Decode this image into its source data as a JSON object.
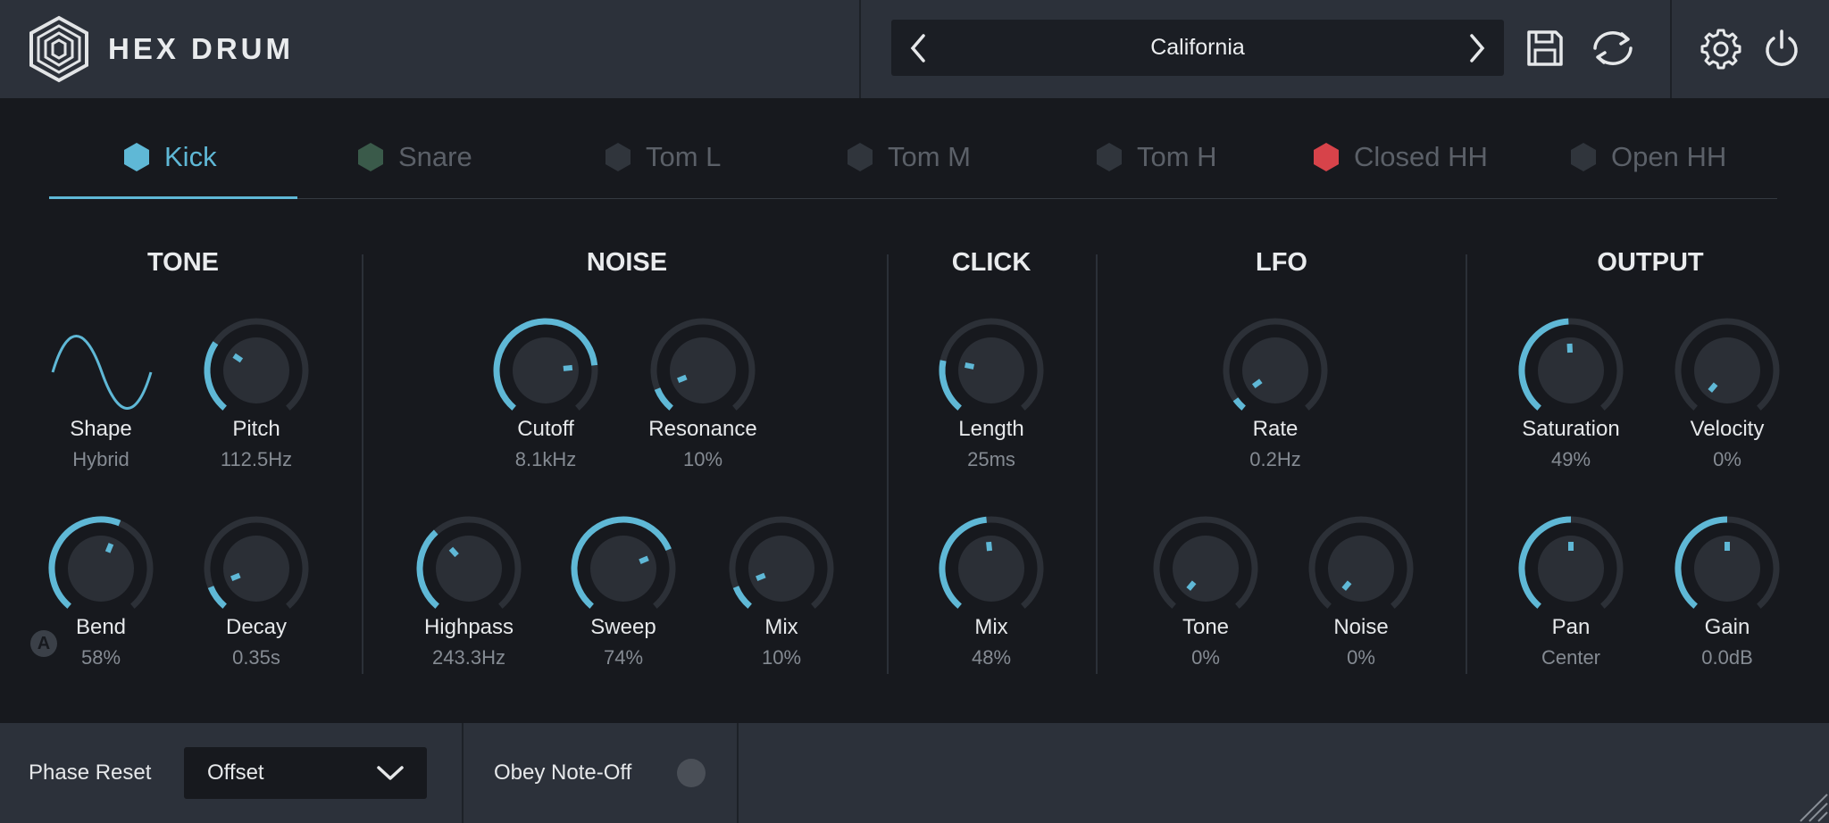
{
  "app": {
    "title": "HEX DRUM"
  },
  "preset": {
    "name": "California"
  },
  "colors": {
    "accent": "#5fb8d6",
    "knob_track": "#2c3037",
    "knob_body": "#2b2f36",
    "closed_hh": "#d7434a",
    "snare": "#3a5a4a"
  },
  "icons": [
    "logo-hex-icon",
    "chevron-left-icon",
    "chevron-right-icon",
    "save-icon",
    "sync-icon",
    "gear-icon",
    "power-icon",
    "chevron-down-icon",
    "resize-grip-icon",
    "sine-wave-icon"
  ],
  "tabs": [
    {
      "label": "Kick",
      "active": true,
      "color": "#5fb8d6"
    },
    {
      "label": "Snare",
      "active": false,
      "color": "#3a5a4a"
    },
    {
      "label": "Tom L",
      "active": false,
      "color": "#30353c"
    },
    {
      "label": "Tom M",
      "active": false,
      "color": "#30353c"
    },
    {
      "label": "Tom H",
      "active": false,
      "color": "#30353c"
    },
    {
      "label": "Closed HH",
      "active": false,
      "color": "#d7434a"
    },
    {
      "label": "Open HH",
      "active": false,
      "color": "#30353c"
    }
  ],
  "sections": {
    "tone": {
      "title": "TONE",
      "shape": {
        "label": "Shape",
        "value": "Hybrid"
      },
      "pitch": {
        "label": "Pitch",
        "value": "112.5Hz",
        "level": 0.3
      },
      "bend": {
        "label": "Bend",
        "value": "58%",
        "level": 0.58,
        "badge": "A"
      },
      "decay": {
        "label": "Decay",
        "value": "0.35s",
        "level": 0.1
      }
    },
    "noise": {
      "title": "NOISE",
      "cutoff": {
        "label": "Cutoff",
        "value": "8.1kHz",
        "level": 0.8
      },
      "resonance": {
        "label": "Resonance",
        "value": "10%",
        "level": 0.1
      },
      "highpass": {
        "label": "Highpass",
        "value": "243.3Hz",
        "level": 0.35
      },
      "sweep": {
        "label": "Sweep",
        "value": "74%",
        "level": 0.74
      },
      "mix": {
        "label": "Mix",
        "value": "10%",
        "level": 0.1
      }
    },
    "click": {
      "title": "CLICK",
      "length": {
        "label": "Length",
        "value": "25ms",
        "level": 0.22
      },
      "mix": {
        "label": "Mix",
        "value": "48%",
        "level": 0.48
      }
    },
    "lfo": {
      "title": "LFO",
      "rate": {
        "label": "Rate",
        "value": "0.2Hz",
        "level": 0.05
      },
      "tone": {
        "label": "Tone",
        "value": "0%",
        "level": 0.0
      },
      "noise": {
        "label": "Noise",
        "value": "0%",
        "level": 0.0
      }
    },
    "output": {
      "title": "OUTPUT",
      "saturation": {
        "label": "Saturation",
        "value": "49%",
        "level": 0.49
      },
      "velocity": {
        "label": "Velocity",
        "value": "0%",
        "level": 0.0
      },
      "pan": {
        "label": "Pan",
        "value": "Center",
        "level": 0.5
      },
      "gain": {
        "label": "Gain",
        "value": "0.0dB",
        "level": 0.5
      }
    }
  },
  "footer": {
    "phase_reset_label": "Phase Reset",
    "phase_reset_value": "Offset",
    "obey_note_off_label": "Obey Note-Off",
    "obey_note_off_on": false
  }
}
